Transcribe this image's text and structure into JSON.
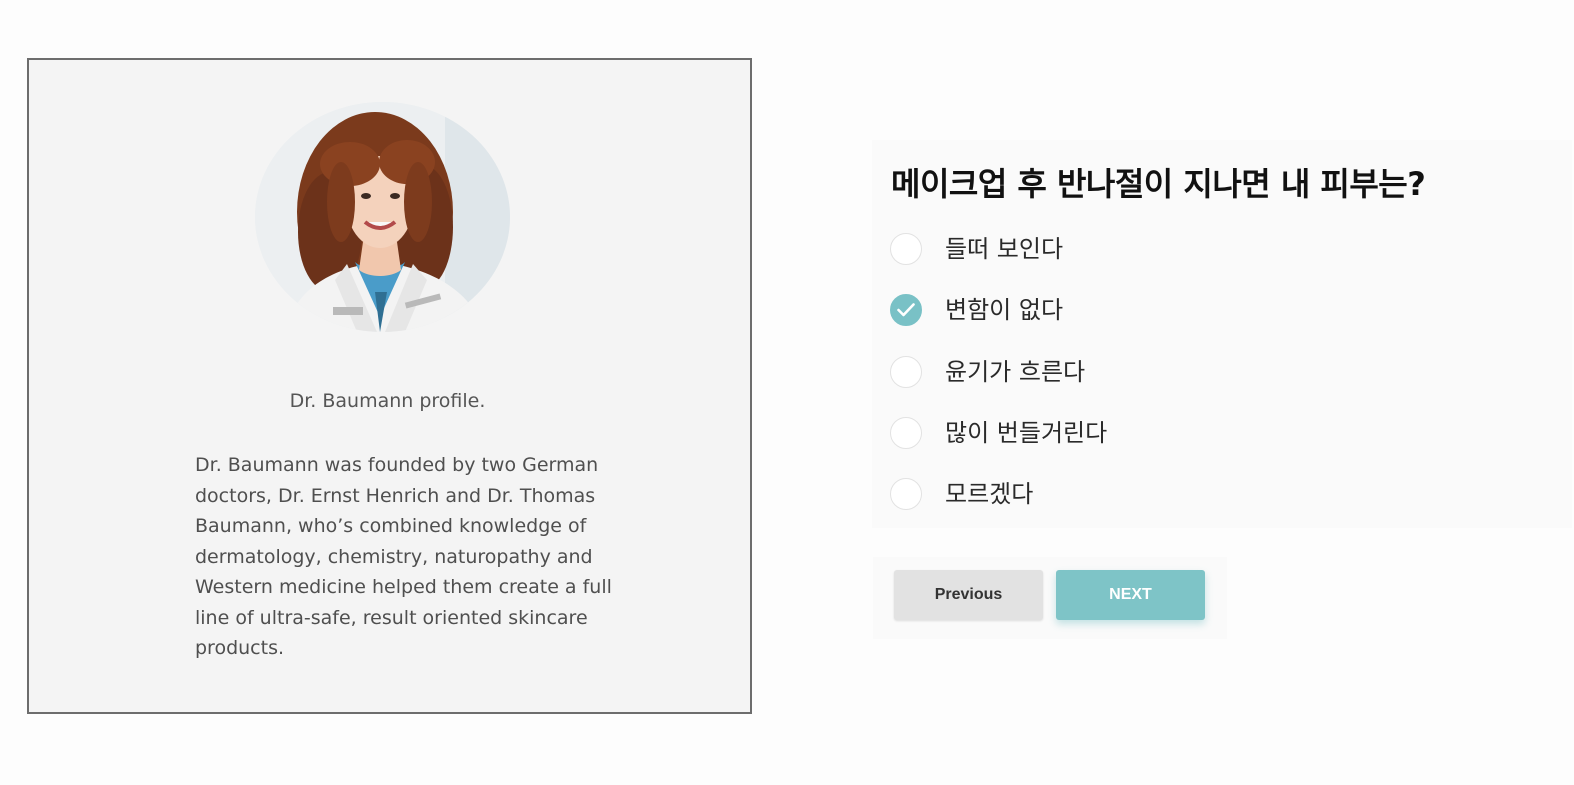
{
  "profile": {
    "caption": "Dr. Baumann profile.",
    "description": "Dr. Baumann was founded by two German doctors, Dr. Ernst Henrich and Dr. Thomas Baumann, who’s combined knowledge of dermatology, chemistry, naturopathy and Western medicine helped them create a full line of ultra-safe, result oriented skincare products."
  },
  "quiz": {
    "question": "메이크업 후 반나절이 지나면 내 피부는?",
    "options": [
      {
        "label": "들떠 보인다",
        "selected": false
      },
      {
        "label": "변함이 없다",
        "selected": true
      },
      {
        "label": "윤기가 흐른다",
        "selected": false
      },
      {
        "label": "많이 번들거린다",
        "selected": false
      },
      {
        "label": "모르겠다",
        "selected": false
      }
    ]
  },
  "buttons": {
    "previous_label": "Previous",
    "next_label": "NEXT"
  },
  "colors": {
    "accent": "#79c1c6",
    "card_border": "#6d6d6d",
    "card_background": "#f4f4f4"
  },
  "icons": {
    "selected_radio": "checkmark-icon"
  }
}
